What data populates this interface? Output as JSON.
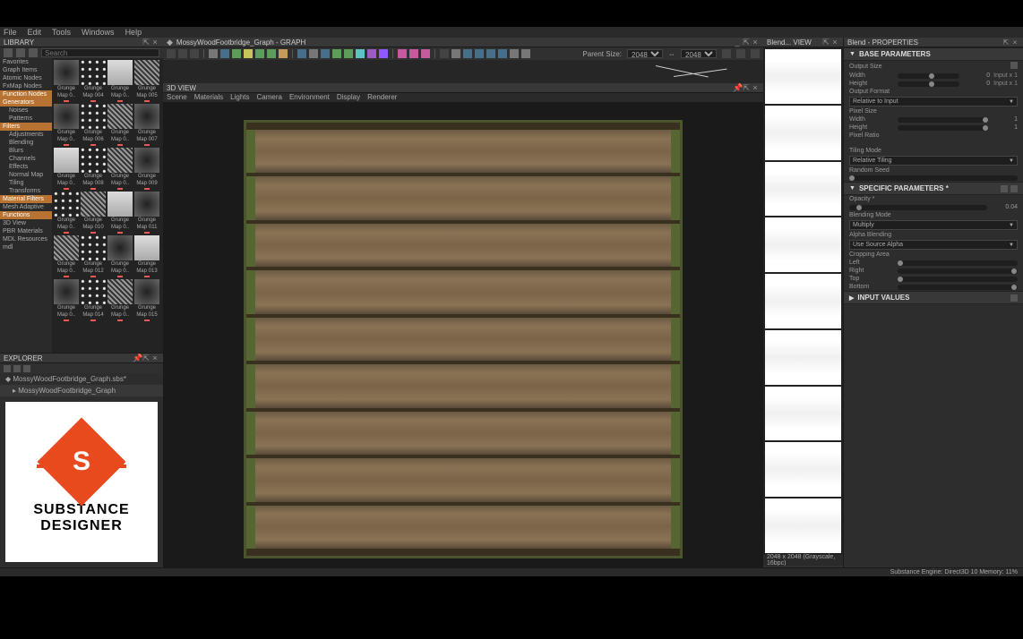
{
  "menubar": [
    "File",
    "Edit",
    "Tools",
    "Windows",
    "Help"
  ],
  "library": {
    "title": "LIBRARY",
    "search_placeholder": "Search",
    "tree": [
      {
        "label": "Favorites",
        "sel": false
      },
      {
        "label": "Graph Items",
        "sel": false
      },
      {
        "label": "Atomic Nodes",
        "sel": false
      },
      {
        "label": "FxMap Nodes",
        "sel": false
      },
      {
        "label": "Function Nodes",
        "sel": true
      },
      {
        "label": "Generators",
        "sel": true
      },
      {
        "label": "Noises",
        "sel": false,
        "sub": true
      },
      {
        "label": "Patterns",
        "sel": false,
        "sub": true
      },
      {
        "label": "Filters",
        "sel": true
      },
      {
        "label": "Adjustments",
        "sel": false,
        "sub": true
      },
      {
        "label": "Blending",
        "sel": false,
        "sub": true
      },
      {
        "label": "Blurs",
        "sel": false,
        "sub": true
      },
      {
        "label": "Channels",
        "sel": false,
        "sub": true
      },
      {
        "label": "Effects",
        "sel": false,
        "sub": true
      },
      {
        "label": "Normal Map",
        "sel": false,
        "sub": true
      },
      {
        "label": "Tiling",
        "sel": false,
        "sub": true
      },
      {
        "label": "Transforms",
        "sel": false,
        "sub": true
      },
      {
        "label": "Material Filters",
        "sel": true
      },
      {
        "label": "Mesh Adaptive",
        "sel": false
      },
      {
        "label": "Functions",
        "sel": true
      },
      {
        "label": "3D View",
        "sel": false
      },
      {
        "label": "PBR Materials",
        "sel": false
      },
      {
        "label": "MDL Resources",
        "sel": false
      },
      {
        "label": "mdl",
        "sel": false
      }
    ],
    "thumbs": [
      {
        "l1": "Grunge",
        "l2": "Map 0..",
        "v": "dark"
      },
      {
        "l1": "Grunge",
        "l2": "Map 004",
        "v": "spots"
      },
      {
        "l1": "Grunge",
        "l2": "Map 0..",
        "v": "light"
      },
      {
        "l1": "Grunge",
        "l2": "Map 005",
        "v": ""
      },
      {
        "l1": "Grunge",
        "l2": "Map 0..",
        "v": "dark"
      },
      {
        "l1": "Grunge",
        "l2": "Map 006",
        "v": "spots"
      },
      {
        "l1": "Grunge",
        "l2": "Map 0..",
        "v": ""
      },
      {
        "l1": "Grunge",
        "l2": "Map 007",
        "v": "dark"
      },
      {
        "l1": "Grunge",
        "l2": "Map 0..",
        "v": "light"
      },
      {
        "l1": "Grunge",
        "l2": "Map 008",
        "v": "spots"
      },
      {
        "l1": "Grunge",
        "l2": "Map 0..",
        "v": ""
      },
      {
        "l1": "Grunge",
        "l2": "Map 009",
        "v": "dark"
      },
      {
        "l1": "Grunge",
        "l2": "Map 0..",
        "v": "spots"
      },
      {
        "l1": "Grunge",
        "l2": "Map 010",
        "v": ""
      },
      {
        "l1": "Grunge",
        "l2": "Map 0..",
        "v": "light"
      },
      {
        "l1": "Grunge",
        "l2": "Map 011",
        "v": "dark"
      },
      {
        "l1": "Grunge",
        "l2": "Map 0..",
        "v": ""
      },
      {
        "l1": "Grunge",
        "l2": "Map 012",
        "v": "spots"
      },
      {
        "l1": "Grunge",
        "l2": "Map 0..",
        "v": "dark"
      },
      {
        "l1": "Grunge",
        "l2": "Map 013",
        "v": "light"
      },
      {
        "l1": "Grunge",
        "l2": "Map 0..",
        "v": "dark"
      },
      {
        "l1": "Grunge",
        "l2": "Map 014",
        "v": "spots"
      },
      {
        "l1": "Grunge",
        "l2": "Map 0..",
        "v": ""
      },
      {
        "l1": "Grunge",
        "l2": "Map 015",
        "v": "dark"
      }
    ]
  },
  "explorer": {
    "title": "EXPLORER",
    "items": [
      {
        "label": "MossyWoodFootbridge_Graph.sbs*",
        "type": "pkg"
      },
      {
        "label": "MossyWoodFootbridge_Graph",
        "type": "file"
      }
    ]
  },
  "logo": {
    "line1": "SUBSTANCE",
    "line2": "DESIGNER"
  },
  "graph": {
    "tab": "MossyWoodFootbridge_Graph - GRAPH",
    "parent_size_label": "Parent Size:",
    "parent_w": "2048",
    "parent_h": "2048"
  },
  "view3d": {
    "title": "3D VIEW",
    "menu": [
      "Scene",
      "Materials",
      "Lights",
      "Camera",
      "Environment",
      "Display",
      "Renderer"
    ]
  },
  "blend_view": {
    "title": "Blend... VIEW",
    "status": "2048 x 2048 (Grayscale, 16bpc)"
  },
  "properties": {
    "title": "Blend - PROPERTIES",
    "base": {
      "header": "BASE PARAMETERS",
      "output_size": "Output Size",
      "width_label": "Width",
      "height_label": "Height",
      "width_val": "0",
      "height_val": "0",
      "input_x1": "Input x 1",
      "output_format": "Output Format",
      "output_format_val": "Relative to Input",
      "pixel_size": "Pixel Size",
      "pixel_ratio": "Pixel Ratio",
      "tiling_mode": "Tiling Mode",
      "tiling_val": "Relative Tiling",
      "random_seed": "Random Seed"
    },
    "specific": {
      "header": "SPECIFIC PARAMETERS *",
      "opacity": "Opacity *",
      "opacity_val": "0.04",
      "blending_mode": "Blending Mode",
      "blending_val": "Multiply",
      "alpha_blending": "Alpha Blending",
      "alpha_val": "Use Source Alpha",
      "cropping": "Cropping Area",
      "left": "Left",
      "right": "Right",
      "top": "Top",
      "bottom": "Bottom"
    },
    "input_values": "INPUT VALUES"
  },
  "statusbar": {
    "right": "Substance Engine: Direct3D 10   Memory: 11%"
  }
}
